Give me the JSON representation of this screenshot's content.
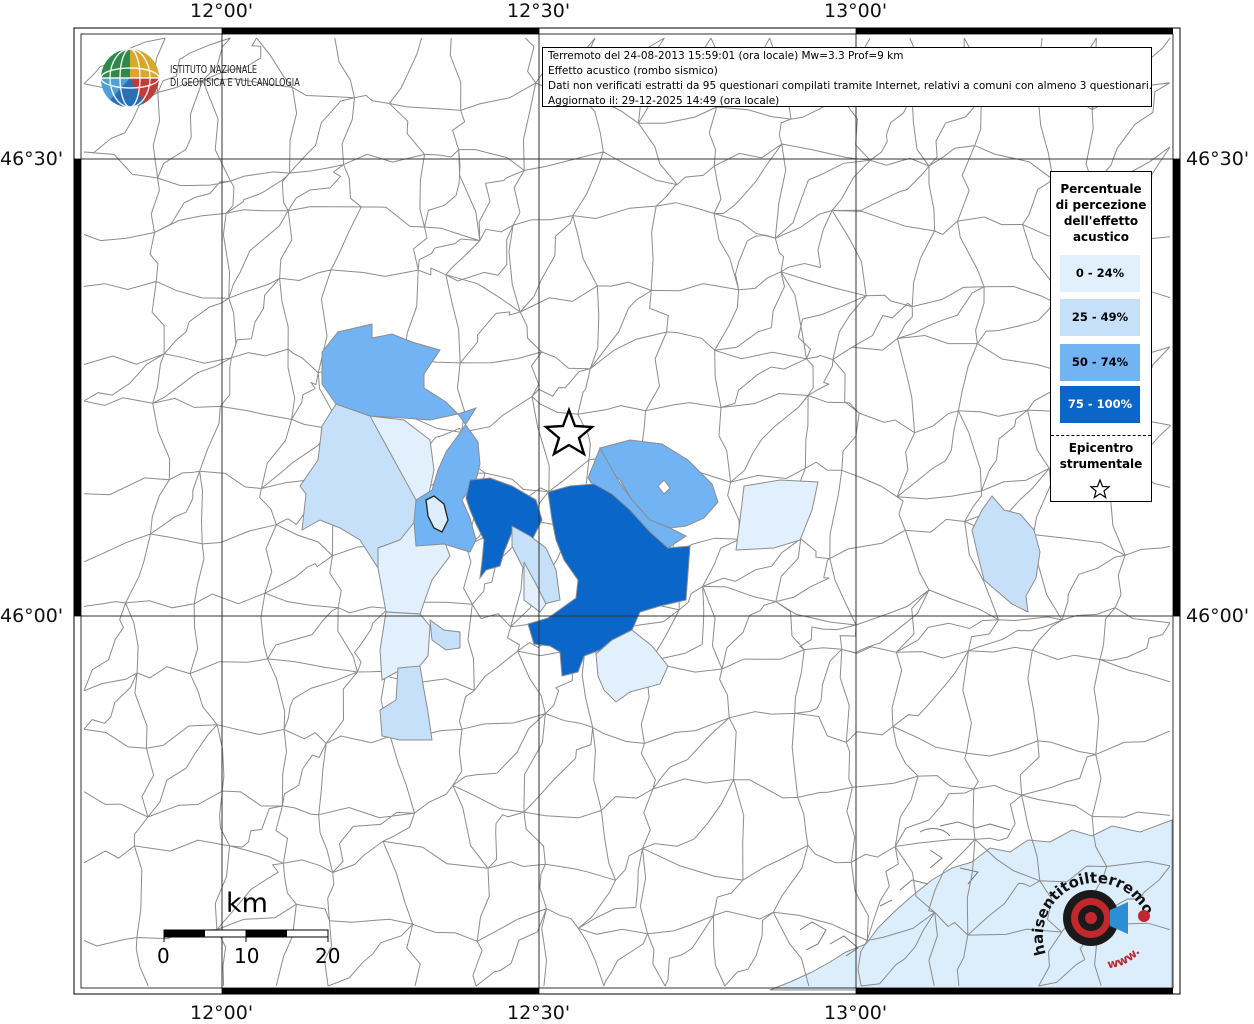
{
  "map": {
    "longitude_labels": [
      "12°00'",
      "12°30'",
      "13°00'"
    ],
    "latitude_labels": [
      "46°30'",
      "46°00'"
    ]
  },
  "info": {
    "line1": "Terremoto del 24-08-2013 15:59:01 (ora locale) Mw=3.3 Prof=9 km",
    "line2": "Effetto acustico (rombo sismico)",
    "line3": "Dati non verificati estratti da 95 questionari compilati tramite Internet, relativi a comuni con almeno 3 questionari.",
    "line4": "Aggiornato il: 29-12-2025 14:49 (ora locale)"
  },
  "logo": {
    "line1": "ISTITUTO NAZIONALE",
    "line2": "DI GEOFISICA E VULCANOLOGIA"
  },
  "legend": {
    "title_lines": [
      "Percentuale",
      "di percezione",
      "dell'effetto",
      "acustico"
    ],
    "classes": [
      {
        "label": "0 - 24%",
        "color": "#e1f0fc"
      },
      {
        "label": "25 - 49%",
        "color": "#c6e0fa"
      },
      {
        "label": "50 - 74%",
        "color": "#72b3f3"
      },
      {
        "label": "75 - 100%",
        "color": "#0a66c9"
      }
    ],
    "epicentre_lines": [
      "Epicentro",
      "strumentale"
    ]
  },
  "scale": {
    "unit": "km",
    "ticks": [
      "0",
      "10",
      "20"
    ]
  },
  "brand": {
    "logo_text": "haisentitoilterremoto.it",
    "www_text": "www."
  },
  "colors": {
    "sea": "#dcedfb",
    "boundary": "#8c8c8c",
    "grid": "#333333"
  }
}
